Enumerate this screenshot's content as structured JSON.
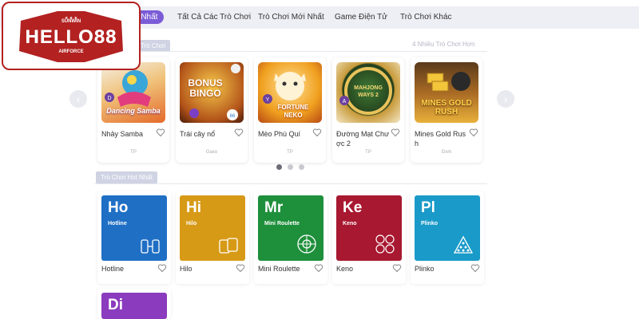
{
  "nav": {
    "tabs": [
      "ít Nhất",
      "Tất Cả Các Trò Chơi",
      "Trò Chơi Mới Nhất",
      "Game Điện Tử",
      "Trò Chơi Khác"
    ]
  },
  "featured": {
    "section_label": "Trò Chơi",
    "more_link": "4 Nhiều Trò Chơi Hơn",
    "games": [
      {
        "name": "Nhảy Samba",
        "provider": "TP",
        "art": "Dancing Samba"
      },
      {
        "name": "Trái cây nổ",
        "provider": "Gaxo",
        "art": "BONUS BINGO"
      },
      {
        "name": "Mèo Phú Quí",
        "provider": "TP",
        "art": "FORTUNE NEKO"
      },
      {
        "name": "Đường Mạt Chư ợc 2",
        "provider": "TP",
        "art": "MAHJONG WAYS 2"
      },
      {
        "name": "Mines Gold Rus h",
        "provider": "Gxm",
        "art": "MINES GOLD RUSH"
      }
    ],
    "dots": 3,
    "active_dot": 0,
    "prev_arrow": "‹",
    "next_arrow": "›"
  },
  "quick_games": {
    "section_label": "Trò Chơi Hot Nhất",
    "games": [
      {
        "abbr": "Ho",
        "full": "Hotline",
        "name": "Hotline",
        "color": "#1f6fc5",
        "icon": "hotline-icon"
      },
      {
        "abbr": "Hi",
        "full": "Hilo",
        "name": "Hilo",
        "color": "#d79a17",
        "icon": "cards-icon"
      },
      {
        "abbr": "Mr",
        "full": "Mini Roulette",
        "name": "Mini Roulette",
        "color": "#1e8f3b",
        "icon": "roulette-icon"
      },
      {
        "abbr": "Ke",
        "full": "Keno",
        "name": "Keno",
        "color": "#a81830",
        "icon": "keno-balls-icon"
      },
      {
        "abbr": "Pl",
        "full": "Plinko",
        "name": "Plinko",
        "color": "#1a9ac9",
        "icon": "plinko-pyramid-icon"
      },
      {
        "abbr": "Di",
        "full": "",
        "name": "",
        "color": "#8b3bbd",
        "icon": ""
      }
    ]
  },
  "logo": {
    "top_text": "SUNWIN",
    "main_text": "HELLO88",
    "bottom_text": "AIRFORCE",
    "brand_color": "#b32121"
  }
}
